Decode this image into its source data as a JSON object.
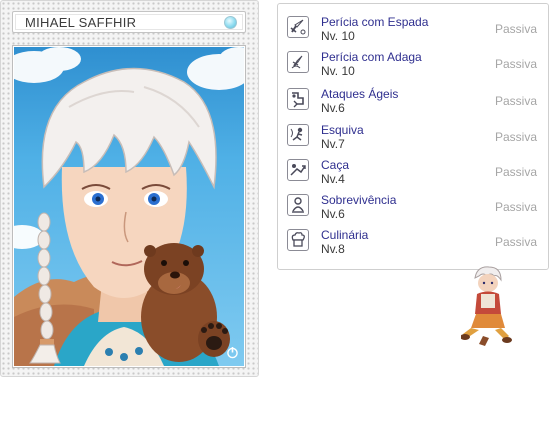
{
  "character": {
    "name": "MIHAEL SAFFHIR"
  },
  "skills": [
    {
      "icon": "sword-skill-icon",
      "name": "Perícia com Espada",
      "level": "Nv. 10",
      "type": "Passiva"
    },
    {
      "icon": "dagger-skill-icon",
      "name": "Perícia com Adaga",
      "level": "Nv. 10",
      "type": "Passiva"
    },
    {
      "icon": "agile-skill-icon",
      "name": "Ataques Ágeis",
      "level": "Nv.6",
      "type": "Passiva"
    },
    {
      "icon": "dodge-skill-icon",
      "name": "Esquiva",
      "level": "Nv.7",
      "type": "Passiva"
    },
    {
      "icon": "hunt-skill-icon",
      "name": "Caça",
      "level": "Nv.4",
      "type": "Passiva"
    },
    {
      "icon": "survival-skill-icon",
      "name": "Sobrevivência",
      "level": "Nv.6",
      "type": "Passiva"
    },
    {
      "icon": "cooking-skill-icon",
      "name": "Culinária",
      "level": "Nv.8",
      "type": "Passiva"
    }
  ],
  "colors": {
    "skill_name": "#2f2f8f",
    "skill_type": "#a6a6a6",
    "name_indicator": "#8fdcf0"
  }
}
